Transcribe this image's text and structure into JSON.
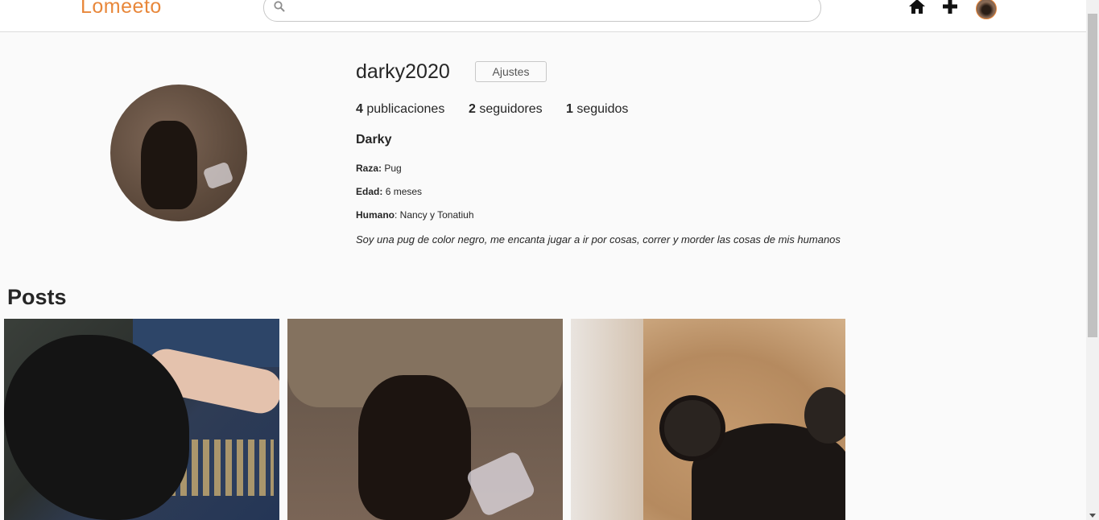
{
  "header": {
    "logo": "Lomeeto",
    "search": {
      "value": "",
      "placeholder": ""
    },
    "nav": {
      "home_icon": "home-icon",
      "add_icon": "plus-icon",
      "avatar": "user-avatar"
    }
  },
  "profile": {
    "username": "darky2020",
    "settings_label": "Ajustes",
    "stats": {
      "posts_count": "4",
      "posts_label": "publicaciones",
      "followers_count": "2",
      "followers_label": "seguidores",
      "following_count": "1",
      "following_label": "seguidos"
    },
    "display_name": "Darky",
    "breed_label": "Raza:",
    "breed_value": "Pug",
    "age_label": "Edad:",
    "age_value": "6 meses",
    "human_label": "Humano",
    "human_value": ": Nancy y Tonatiuh",
    "bio": "Soy una pug de color negro, me encanta jugar a ir por cosas, correr y morder las cosas de mis humanos"
  },
  "posts": {
    "title": "Posts"
  },
  "colors": {
    "brand": "#e8873a",
    "background": "#fafafa",
    "text": "#262626"
  }
}
